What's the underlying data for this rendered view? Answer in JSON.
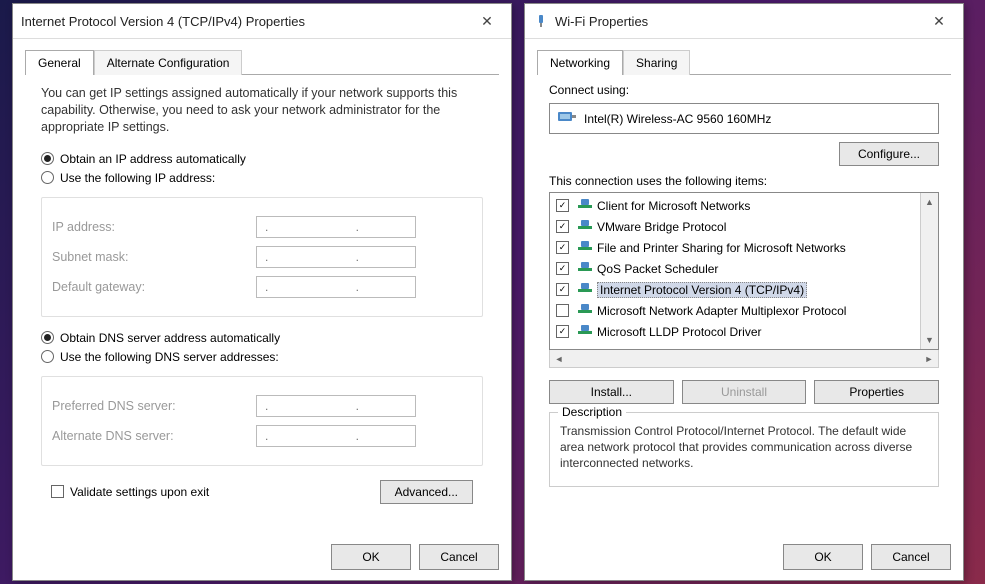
{
  "leftDialog": {
    "title": "Internet Protocol Version 4 (TCP/IPv4) Properties",
    "tabs": {
      "general": "General",
      "alternate": "Alternate Configuration"
    },
    "description": "You can get IP settings assigned automatically if your network supports this capability. Otherwise, you need to ask your network administrator for the appropriate IP settings.",
    "radios": {
      "obtainIpAuto": "Obtain an IP address automatically",
      "useIp": "Use the following IP address:",
      "obtainDnsAuto": "Obtain DNS server address automatically",
      "useDns": "Use the following DNS server addresses:"
    },
    "fields": {
      "ipAddress": "IP address:",
      "subnet": "Subnet mask:",
      "gateway": "Default gateway:",
      "prefDns": "Preferred DNS server:",
      "altDns": "Alternate DNS server:",
      "dots": ".       .       ."
    },
    "validate": "Validate settings upon exit",
    "advanced": "Advanced...",
    "ok": "OK",
    "cancel": "Cancel"
  },
  "rightDialog": {
    "title": "Wi-Fi Properties",
    "tabs": {
      "networking": "Networking",
      "sharing": "Sharing"
    },
    "connectUsing": "Connect using:",
    "adapter": "Intel(R) Wireless-AC 9560 160MHz",
    "configure": "Configure...",
    "itemsLabel": "This connection uses the following items:",
    "items": [
      {
        "checked": true,
        "icon": "💻",
        "color": "#2a7",
        "text": "Client for Microsoft Networks"
      },
      {
        "checked": true,
        "icon": "📦",
        "color": "#2a7",
        "text": "VMware Bridge Protocol"
      },
      {
        "checked": true,
        "icon": "📁",
        "color": "#2a7",
        "text": "File and Printer Sharing for Microsoft Networks"
      },
      {
        "checked": true,
        "icon": "💻",
        "color": "#2a7",
        "text": "QoS Packet Scheduler"
      },
      {
        "checked": true,
        "icon": "⬆",
        "color": "#2a7",
        "text": "Internet Protocol Version 4 (TCP/IPv4)",
        "selected": true
      },
      {
        "checked": false,
        "icon": "⬆",
        "color": "#2a7",
        "text": "Microsoft Network Adapter Multiplexor Protocol"
      },
      {
        "checked": true,
        "icon": "⬆",
        "color": "#2a7",
        "text": "Microsoft LLDP Protocol Driver"
      }
    ],
    "install": "Install...",
    "uninstall": "Uninstall",
    "properties": "Properties",
    "descLabel": "Description",
    "descText": "Transmission Control Protocol/Internet Protocol. The default wide area network protocol that provides communication across diverse interconnected networks.",
    "ok": "OK",
    "cancel": "Cancel"
  }
}
